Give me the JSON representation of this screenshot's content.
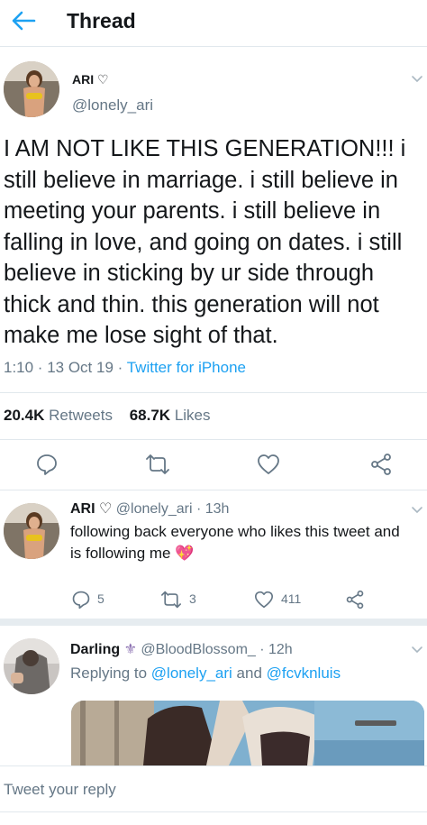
{
  "header": {
    "title": "Thread"
  },
  "main_tweet": {
    "name": "ARI ♡",
    "handle": "@lonely_ari",
    "text": "I AM NOT LIKE THIS GENERATION!!! i still believe in marriage. i still believe in meeting your parents. i still believe in falling in love, and going on dates. i still believe in sticking by ur side through thick and thin. this generation will not make me lose sight of that.",
    "time": "1:10 · 13 Oct 19 · ",
    "source": "Twitter for iPhone",
    "retweets_count": "20.4K",
    "retweets_label": "Retweets",
    "likes_count": "68.7K",
    "likes_label": "Likes"
  },
  "reply1": {
    "name": "ARI ♡",
    "handle": "@lonely_ari · 13h",
    "text": "following back everyone who likes this tweet and is following me 💖",
    "reply_count": "5",
    "retweet_count": "3",
    "like_count": "411"
  },
  "reply2": {
    "name": "Darling",
    "badge": "⚜",
    "handle": "@BloodBlossom_ · 12h",
    "replying_prefix": "Replying to ",
    "replying_to_1": "@lonely_ari",
    "replying_and": " and ",
    "replying_to_2": "@fcvknluis"
  },
  "composer": {
    "placeholder": "Tweet your reply"
  },
  "colors": {
    "accent": "#1da1f2",
    "secondary_text": "#657786",
    "divider": "#e1e8ed"
  }
}
